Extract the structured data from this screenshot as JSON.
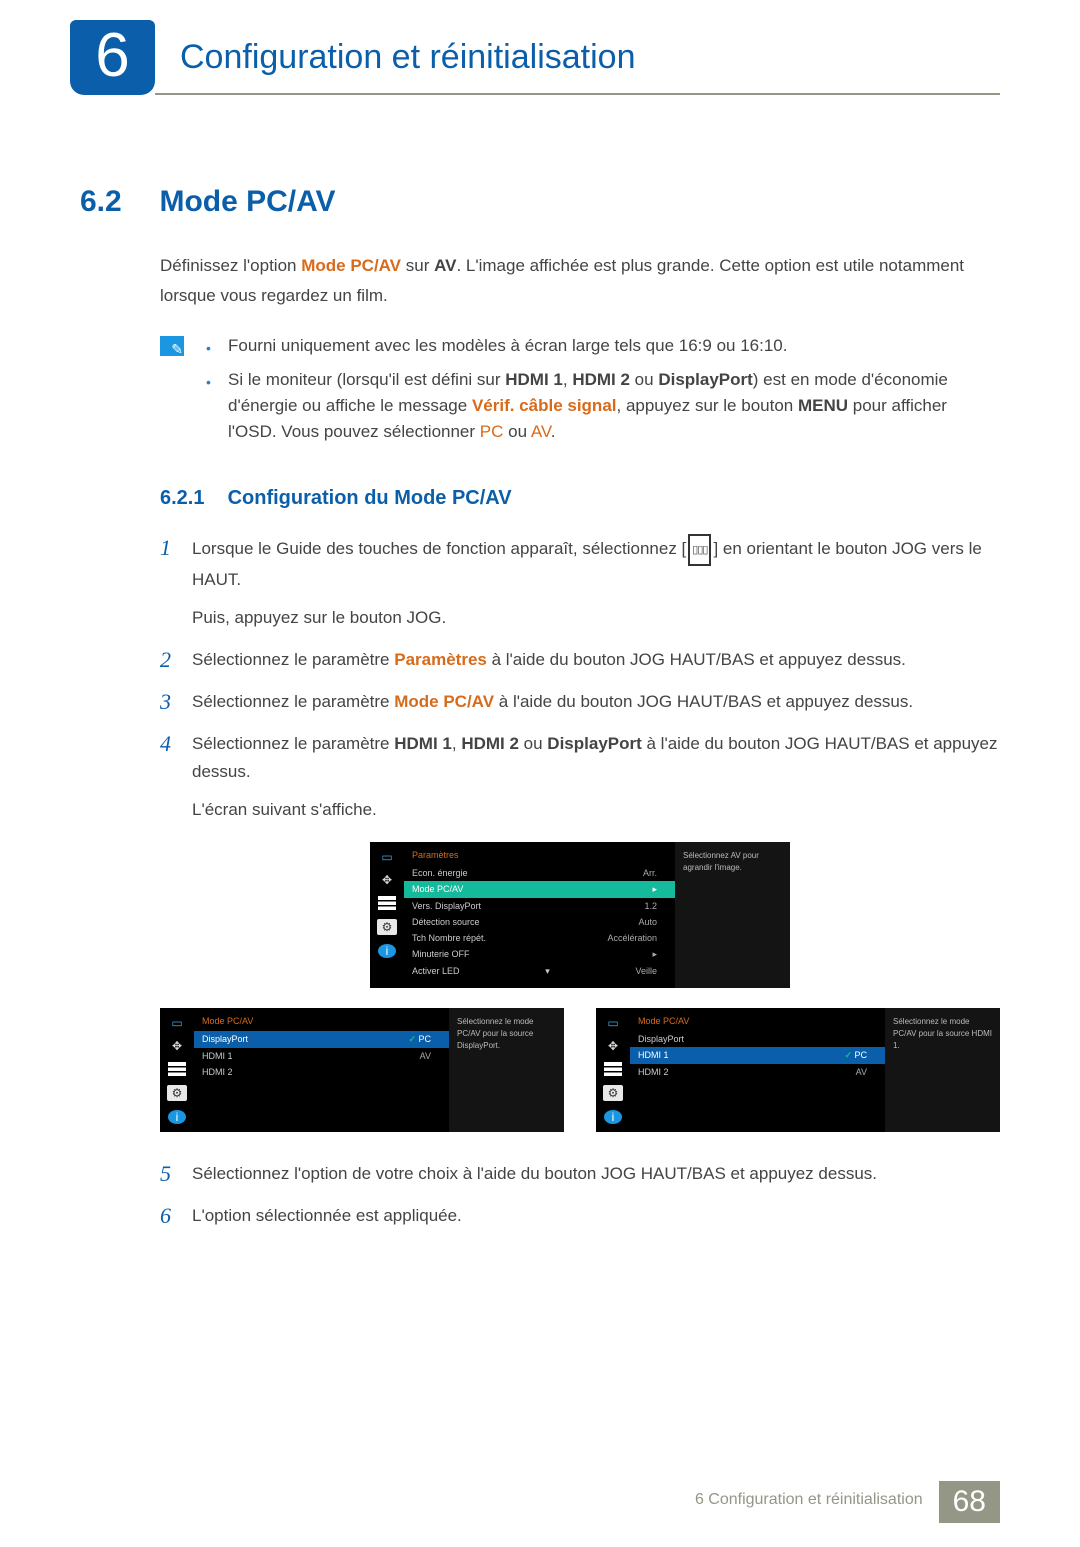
{
  "header": {
    "chapter_number": "6",
    "chapter_title": "Configuration et réinitialisation"
  },
  "section": {
    "number": "6.2",
    "title": "Mode PC/AV"
  },
  "intro": {
    "p1a": "Définissez l'option ",
    "p1b": "Mode PC/AV",
    "p1c": " sur ",
    "p1d": "AV",
    "p1e": ". L'image affichée est plus grande. Cette option est utile notamment lorsque vous regardez un film."
  },
  "notes": {
    "n1": "Fourni uniquement avec les modèles à écran large tels que 16:9 ou 16:10.",
    "n2a": "Si le moniteur (lorsqu'il est défini sur ",
    "n2b": "HDMI 1",
    "n2c": ", ",
    "n2d": "HDMI 2",
    "n2e": " ou ",
    "n2f": "DisplayPort",
    "n2g": ") est en mode d'économie d'énergie ou affiche le message ",
    "n2h": "Vérif. câble signal",
    "n2i": ", appuyez sur le bouton ",
    "n2j": "MENU",
    "n2k": " pour afficher l'OSD. Vous pouvez sélectionner ",
    "n2l": "PC",
    "n2m": " ou ",
    "n2n": "AV",
    "n2o": "."
  },
  "subsection": {
    "number": "6.2.1",
    "title": "Configuration du Mode PC/AV"
  },
  "steps": {
    "s1": {
      "num": "1",
      "a": "Lorsque le Guide des touches de fonction apparaît, sélectionnez [",
      "b": "] en orientant le bouton JOG vers le HAUT.",
      "sub": "Puis, appuyez sur le bouton JOG."
    },
    "s2": {
      "num": "2",
      "a": "Sélectionnez le paramètre ",
      "b": "Paramètres",
      "c": " à l'aide du bouton JOG HAUT/BAS et appuyez dessus."
    },
    "s3": {
      "num": "3",
      "a": "Sélectionnez le paramètre ",
      "b": "Mode PC/AV",
      "c": " à l'aide du bouton JOG HAUT/BAS et appuyez dessus."
    },
    "s4": {
      "num": "4",
      "a": "Sélectionnez le paramètre ",
      "b": "HDMI 1",
      "c": ", ",
      "d": "HDMI 2",
      "e": " ou ",
      "f": "DisplayPort",
      "g": " à l'aide du bouton JOG HAUT/BAS et appuyez dessus.",
      "sub": "L'écran suivant s'affiche."
    },
    "s5": {
      "num": "5",
      "text": "Sélectionnez l'option de votre choix à l'aide du bouton JOG HAUT/BAS et appuyez dessus."
    },
    "s6": {
      "num": "6",
      "text": "L'option sélectionnée est appliquée."
    }
  },
  "osd_main": {
    "title": "Paramètres",
    "items": [
      {
        "label": "Econ. énergie",
        "value": "Arr."
      },
      {
        "label": "Mode PC/AV",
        "value": "▸"
      },
      {
        "label": "Vers. DisplayPort",
        "value": "1.2"
      },
      {
        "label": "Détection source",
        "value": "Auto"
      },
      {
        "label": "Tch Nombre répét.",
        "value": "Accélération"
      },
      {
        "label": "Minuterie OFF",
        "value": "▸"
      },
      {
        "label": "Activer LED",
        "value": "Veille"
      }
    ],
    "hint": "Sélectionnez AV pour agrandir l'image."
  },
  "osd_left": {
    "title": "Mode PC/AV",
    "items": [
      {
        "label": "DisplayPort",
        "opt1": "PC"
      },
      {
        "label": "HDMI 1",
        "opt1": "AV"
      },
      {
        "label": "HDMI 2",
        "opt1": ""
      }
    ],
    "hint": "Sélectionnez le mode PC/AV pour la source DisplayPort."
  },
  "osd_right": {
    "title": "Mode PC/AV",
    "items": [
      {
        "label": "DisplayPort",
        "opt1": ""
      },
      {
        "label": "HDMI 1",
        "opt1": "PC"
      },
      {
        "label": "HDMI 2",
        "opt1": "AV"
      }
    ],
    "hint": "Sélectionnez le mode PC/AV pour la source HDMI 1."
  },
  "footer": {
    "label": "6 Configuration et réinitialisation",
    "page": "68"
  }
}
